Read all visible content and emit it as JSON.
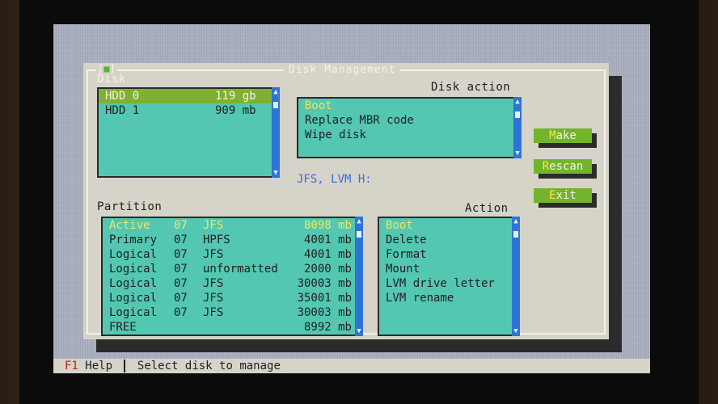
{
  "dialog": {
    "title": "Disk Management",
    "close_glyph": "■"
  },
  "disk": {
    "label": "Disk",
    "items": [
      {
        "name": "HDD 0",
        "size": "119 gb"
      },
      {
        "name": "HDD 1",
        "size": "909 mb"
      }
    ]
  },
  "disk_action": {
    "label": "Disk action",
    "items": [
      "Boot",
      "Replace MBR code",
      "Wipe disk"
    ]
  },
  "info_text": "JFS, LVM H:",
  "buttons": {
    "make_hot": "M",
    "make_rest": "ake",
    "rescan_hot": "R",
    "rescan_rest": "escan",
    "exit_hot": "E",
    "exit_rest": "xit"
  },
  "partition": {
    "label": "Partition",
    "items": [
      {
        "type": "Active",
        "id": "07",
        "fs": "JFS",
        "size": "8098 mb"
      },
      {
        "type": "Primary",
        "id": "07",
        "fs": "HPFS",
        "size": "4001 mb"
      },
      {
        "type": "Logical",
        "id": "07",
        "fs": "JFS",
        "size": "4001 mb"
      },
      {
        "type": "Logical",
        "id": "07",
        "fs": "unformatted",
        "size": "2000 mb"
      },
      {
        "type": "Logical",
        "id": "07",
        "fs": "JFS",
        "size": "30003 mb"
      },
      {
        "type": "Logical",
        "id": "07",
        "fs": "JFS",
        "size": "35001 mb"
      },
      {
        "type": "Logical",
        "id": "07",
        "fs": "JFS",
        "size": "30003 mb"
      },
      {
        "type": "FREE",
        "id": "",
        "fs": "",
        "size": "8992 mb"
      }
    ]
  },
  "action": {
    "label": "Action",
    "items": [
      "Boot",
      "Delete",
      "Format",
      "Mount",
      "LVM drive letter",
      "LVM rename"
    ]
  },
  "statusbar": {
    "key": "F1",
    "key_label": "Help",
    "message": "Select disk to manage"
  },
  "icons": {
    "scroll_up": "▲",
    "scroll_down": "▼"
  },
  "colors": {
    "list_bg": "#53c7b2",
    "selection": "#7fb02e",
    "highlight_text": "#f4e55a",
    "scrollbar": "#2d74d6",
    "button": "#74b42c",
    "info_text": "#3b6ee0"
  }
}
